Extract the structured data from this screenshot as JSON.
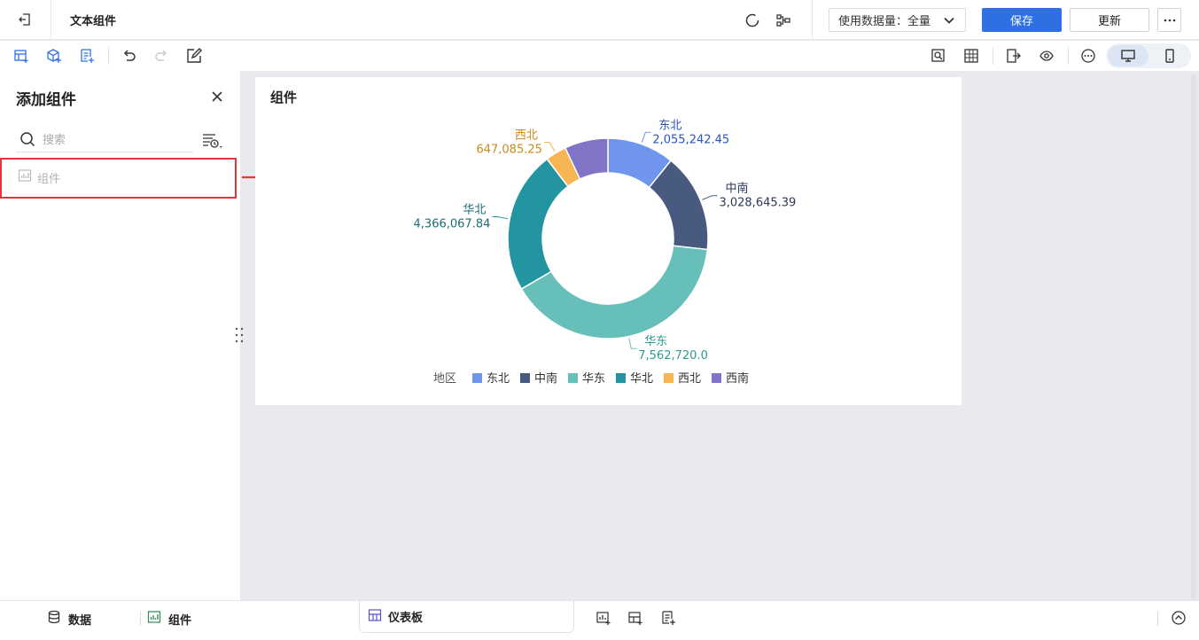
{
  "topbar": {
    "title": "文本组件",
    "data_select": "使用数据量：全量",
    "save_label": "保存",
    "update_label": "更新"
  },
  "panel": {
    "title": "添加组件",
    "search_placeholder": "搜索",
    "component_item": "组件"
  },
  "card": {
    "title": "组件"
  },
  "chart_data": {
    "type": "pie",
    "donut": true,
    "legend_title": "地区",
    "legend_position": "bottom",
    "series": [
      {
        "name": "东北",
        "value": 2055242.45,
        "label": "2,055,242.45",
        "color": "#6f95ec"
      },
      {
        "name": "中南",
        "value": 3028645.39,
        "label": "3,028,645.39",
        "color": "#485a7f"
      },
      {
        "name": "华东",
        "value": 7562720.0,
        "label": "7,562,720.0",
        "color": "#66bfb8"
      },
      {
        "name": "华北",
        "value": 4366067.84,
        "label": "4,366,067.84",
        "color": "#2395a1"
      },
      {
        "name": "西北",
        "value": 647085.25,
        "label": "647,085.25",
        "color": "#f7b553"
      },
      {
        "name": "西南",
        "value": 1331000.0,
        "label": "",
        "color": "#7f74c6"
      }
    ]
  },
  "bottombar": {
    "data_label": "数据",
    "component_label": "组件",
    "dashboard_tab": "仪表板"
  }
}
